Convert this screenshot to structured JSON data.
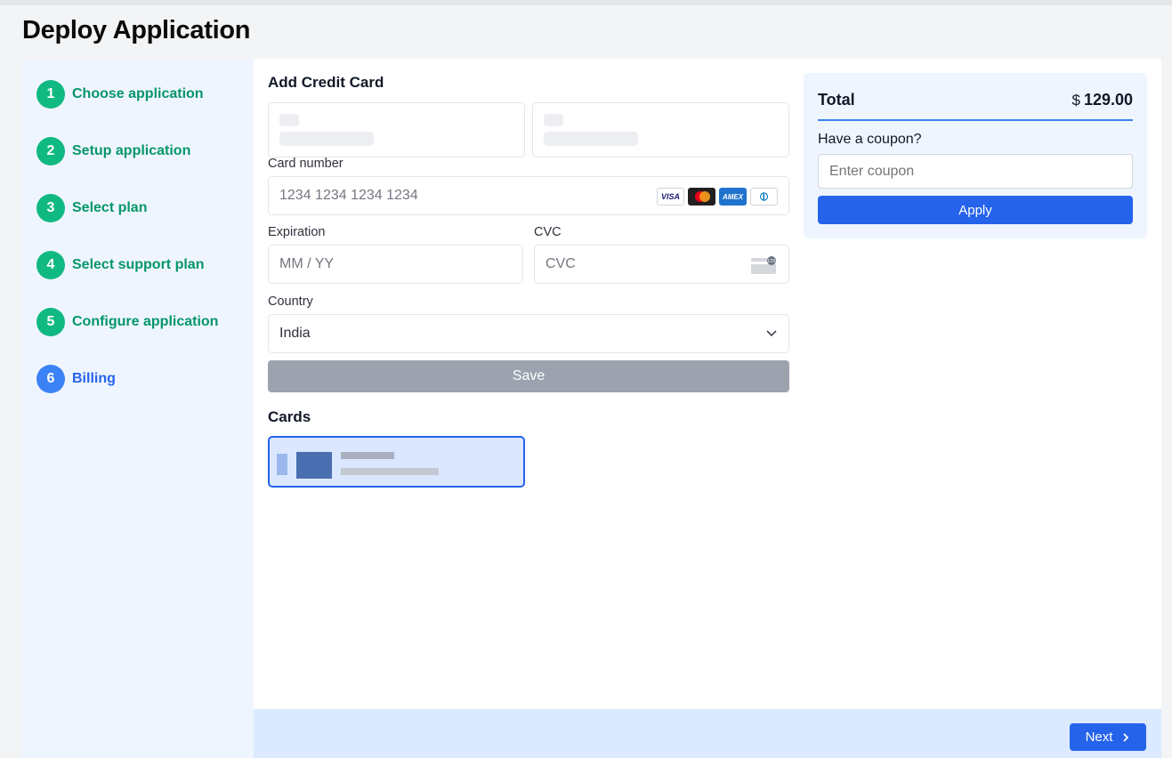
{
  "page": {
    "title": "Deploy Application"
  },
  "steps": [
    {
      "num": "1",
      "label": "Choose application",
      "state": "complete"
    },
    {
      "num": "2",
      "label": "Setup application",
      "state": "complete"
    },
    {
      "num": "3",
      "label": "Select plan",
      "state": "complete"
    },
    {
      "num": "4",
      "label": "Select support plan",
      "state": "complete"
    },
    {
      "num": "5",
      "label": "Configure application",
      "state": "complete"
    },
    {
      "num": "6",
      "label": "Billing",
      "state": "active"
    }
  ],
  "payment": {
    "heading": "Add Credit Card",
    "card_number_label": "Card number",
    "card_number_placeholder": "1234 1234 1234 1234",
    "brands": [
      "VISA",
      "mastercard",
      "AMEX",
      "diners"
    ],
    "expiration_label": "Expiration",
    "expiration_placeholder": "MM / YY",
    "cvc_label": "CVC",
    "cvc_placeholder": "CVC",
    "country_label": "Country",
    "country_value": "India",
    "save_label": "Save"
  },
  "cards": {
    "heading": "Cards"
  },
  "summary": {
    "total_label": "Total",
    "currency": "$",
    "total_value": "129.00",
    "coupon_label": "Have a coupon?",
    "coupon_placeholder": "Enter coupon",
    "apply_label": "Apply"
  },
  "footer": {
    "next_label": "Next"
  },
  "colors": {
    "complete": "#10b981",
    "active": "#3b82f6",
    "primary_button": "#2563eb",
    "disabled_button": "#9ca3af"
  }
}
